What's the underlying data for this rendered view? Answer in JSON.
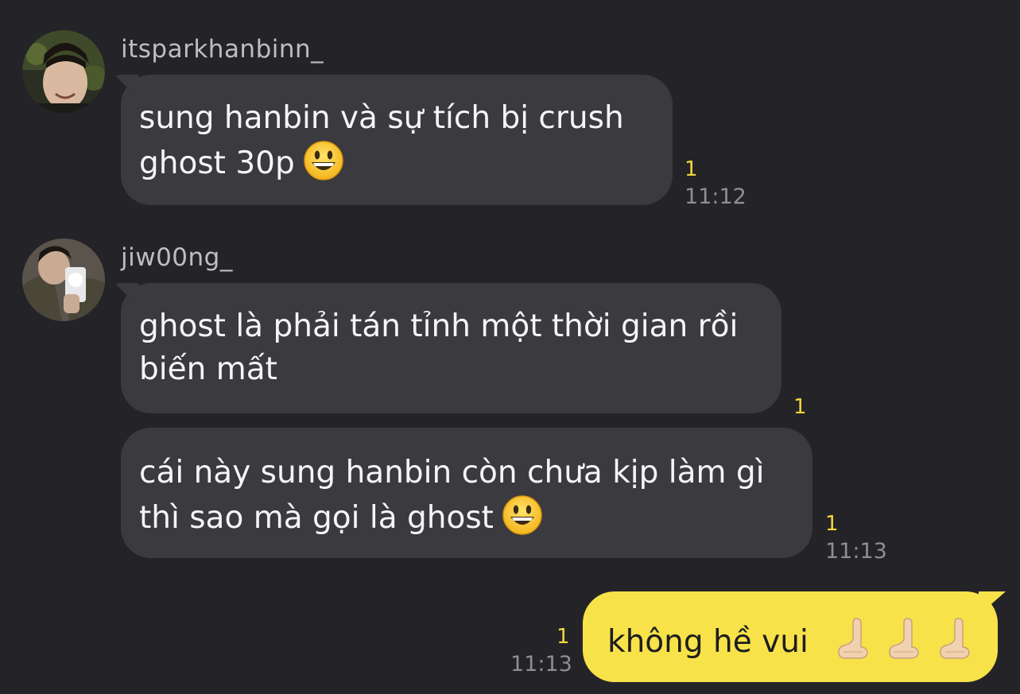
{
  "messages": [
    {
      "sender": "itsparkhanbinn_",
      "text": "sung hanbin và sự tích bị crush ghost 30p",
      "line1": "sung hanbin và sự tích bị crush",
      "line2": "ghost 30p",
      "emoji": "grinning-face",
      "unread": "1",
      "time": "11:12"
    },
    {
      "sender": "jiw00ng_",
      "line1": "ghost là phải tán tỉnh một thời gian rồi",
      "line2": "biến mất",
      "unread": "1"
    },
    {
      "line1": "cái này sung hanbin còn chưa kịp làm gì",
      "line2": "thì sao mà gọi là ghost",
      "emoji": "grinning-face",
      "unread": "1",
      "time": "11:13"
    },
    {
      "mine": true,
      "text": "không hề vui",
      "emoji": "palm-hand x3",
      "unread": "1",
      "time": "11:13"
    }
  ],
  "colors": {
    "background": "#242428",
    "incoming_bubble": "#3a3a3f",
    "outgoing_bubble": "#f8e24a",
    "unread_count": "#f3d63a",
    "timestamp": "#8e8e93",
    "username": "#bdbdc2"
  }
}
